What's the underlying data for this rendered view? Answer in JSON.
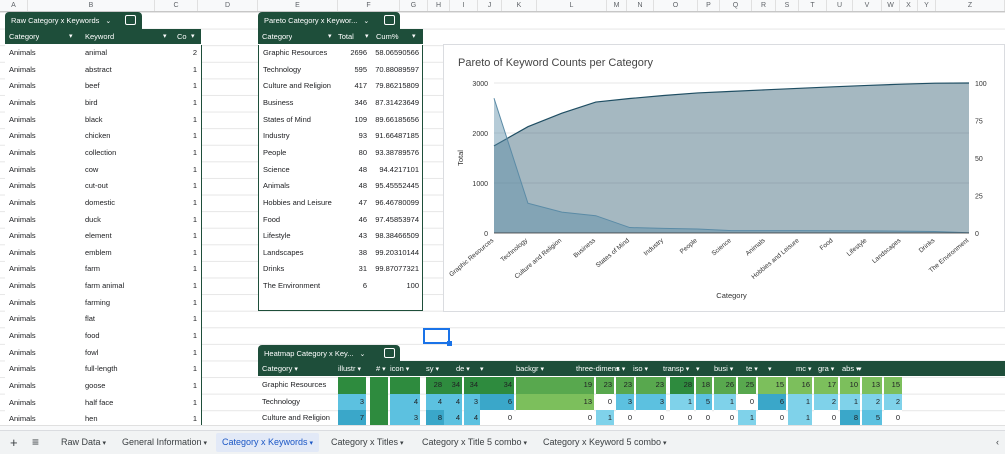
{
  "columns": [
    "A",
    "B",
    "C",
    "D",
    "E",
    "F",
    "G",
    "H",
    "I",
    "J",
    "K",
    "L",
    "M",
    "N",
    "O",
    "P",
    "Q",
    "R",
    "S",
    "T",
    "U",
    "V",
    "W",
    "X",
    "Y",
    "Z"
  ],
  "raw_table": {
    "title": "Raw Category x Keywords",
    "headers": [
      "Category",
      "Keyword",
      "Co"
    ],
    "rows": [
      [
        "Animals",
        "animal",
        "2"
      ],
      [
        "Animals",
        "abstract",
        "1"
      ],
      [
        "Animals",
        "beef",
        "1"
      ],
      [
        "Animals",
        "bird",
        "1"
      ],
      [
        "Animals",
        "black",
        "1"
      ],
      [
        "Animals",
        "chicken",
        "1"
      ],
      [
        "Animals",
        "collection",
        "1"
      ],
      [
        "Animals",
        "cow",
        "1"
      ],
      [
        "Animals",
        "cut-out",
        "1"
      ],
      [
        "Animals",
        "domestic",
        "1"
      ],
      [
        "Animals",
        "duck",
        "1"
      ],
      [
        "Animals",
        "element",
        "1"
      ],
      [
        "Animals",
        "emblem",
        "1"
      ],
      [
        "Animals",
        "farm",
        "1"
      ],
      [
        "Animals",
        "farm animal",
        "1"
      ],
      [
        "Animals",
        "farming",
        "1"
      ],
      [
        "Animals",
        "flat",
        "1"
      ],
      [
        "Animals",
        "food",
        "1"
      ],
      [
        "Animals",
        "fowl",
        "1"
      ],
      [
        "Animals",
        "full-length",
        "1"
      ],
      [
        "Animals",
        "goose",
        "1"
      ],
      [
        "Animals",
        "half face",
        "1"
      ],
      [
        "Animals",
        "hen",
        "1"
      ]
    ]
  },
  "pareto_table": {
    "title": "Pareto Category x Keywor...",
    "headers": [
      "Category",
      "Total",
      "Cum%"
    ],
    "rows": [
      [
        "Graphic Resources",
        "2696",
        "58.06590566"
      ],
      [
        "Technology",
        "595",
        "70.88089597"
      ],
      [
        "Culture and Religion",
        "417",
        "79.86215809"
      ],
      [
        "Business",
        "346",
        "87.31423649"
      ],
      [
        "States of Mind",
        "109",
        "89.66185656"
      ],
      [
        "Industry",
        "93",
        "91.66487185"
      ],
      [
        "People",
        "80",
        "93.38789576"
      ],
      [
        "Science",
        "48",
        "94.4217101"
      ],
      [
        "Animals",
        "48",
        "95.45552445"
      ],
      [
        "Hobbies and Leisure",
        "47",
        "96.46780099"
      ],
      [
        "Food",
        "46",
        "97.45853974"
      ],
      [
        "Lifestyle",
        "43",
        "98.38466509"
      ],
      [
        "Landscapes",
        "38",
        "99.20310144"
      ],
      [
        "Drinks",
        "31",
        "99.87077321"
      ],
      [
        "The Environment",
        "6",
        "100"
      ]
    ]
  },
  "chart_data": {
    "type": "area",
    "title": "Pareto of Keyword Counts per Category",
    "xlabel": "Category",
    "ylabel": "Total",
    "categories": [
      "Graphic Resources",
      "Technology",
      "Culture and Religion",
      "Business",
      "States of Mind",
      "Industry",
      "People",
      "Science",
      "Animals",
      "Hobbies and Leisure",
      "Food",
      "Lifestyle",
      "Landscapes",
      "Drinks",
      "The Environment"
    ],
    "ylim": [
      0,
      3000
    ],
    "y2lim": [
      0,
      100
    ],
    "yticks": [
      "0",
      "1000",
      "2000",
      "3000"
    ],
    "y2ticks": [
      "0",
      "25",
      "50",
      "75",
      "100"
    ],
    "series": [
      {
        "values": [
          2696,
          595,
          417,
          346,
          109,
          93,
          80,
          48,
          48,
          47,
          46,
          43,
          38,
          31,
          6
        ],
        "axis": "left",
        "color": "#5b8ba6"
      },
      {
        "values": [
          58.07,
          70.88,
          79.86,
          87.31,
          89.66,
          91.66,
          93.39,
          94.42,
          95.46,
          96.47,
          97.46,
          98.38,
          99.2,
          99.87,
          100
        ],
        "axis": "right",
        "color": "#1f4e63"
      }
    ],
    "grid": true
  },
  "heatmap": {
    "title": "Heatmap Category x Key...",
    "headers": [
      "Category",
      "illustr",
      "#",
      "icon",
      "sy",
      "de",
      "",
      "backgr",
      "three-dimens",
      "",
      "iso",
      "transp",
      "",
      "busi",
      "te",
      "",
      "mc",
      "gra",
      "abs",
      ""
    ],
    "rows": [
      {
        "label": "Graphic Resources",
        "cells": [
          "",
          "",
          "",
          "28",
          "34",
          "34",
          "34",
          "19",
          "23",
          "23",
          "23",
          "28",
          "18",
          "26",
          "25",
          "15",
          "16",
          "17",
          "10",
          "13",
          "15"
        ]
      },
      {
        "label": "Technology",
        "cells": [
          "3",
          "",
          "4",
          "4",
          "4",
          "3",
          "6",
          "13",
          "0",
          "3",
          "3",
          "1",
          "5",
          "1",
          "0",
          "6",
          "1",
          "2",
          "1",
          "2",
          "2"
        ]
      },
      {
        "label": "Culture and Religion",
        "cells": [
          "7",
          "",
          "3",
          "8",
          "4",
          "4",
          "0",
          "0",
          "1",
          "0",
          "0",
          "0",
          "0",
          "0",
          "1",
          "0",
          "1",
          "0",
          "8",
          "5",
          "0"
        ]
      }
    ]
  },
  "sheet_tabs": [
    "Raw Data",
    "General Information",
    "Category x Keywords",
    "Category x Titles",
    "Category x Title 5 combo",
    "Category x Keyword 5 combo"
  ],
  "active_tab": "Category x Keywords"
}
